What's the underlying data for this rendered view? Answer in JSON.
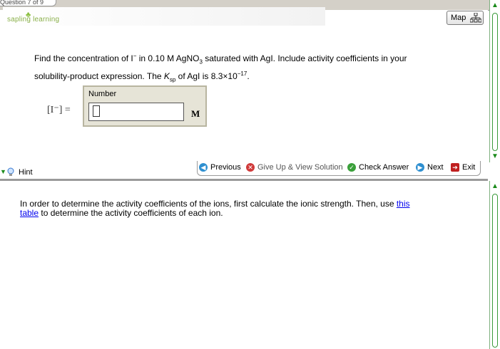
{
  "tabstrip": {
    "title": "Question 7 of 9"
  },
  "logo": {
    "leaf": "♣",
    "text": "sapling learning"
  },
  "map_button": {
    "label": "Map",
    "icon": "sitemap-icon"
  },
  "question": {
    "line1_a": "Find the concentration of I",
    "line1_sup": "−",
    "line1_b": " in 0.10 M AgNO",
    "line1_sub": "3",
    "line1_c": " saturated with AgI. Include activity coefficients in your",
    "line2_a": "solubility-product expression. The ",
    "line2_k": "K",
    "line2_ksub": "sp",
    "line2_b": " of AgI is 8.3×10",
    "line2_sup": "−17",
    "line2_c": "."
  },
  "answer": {
    "label": "Number",
    "value": "",
    "unit": "M",
    "ion_label": "[I⁻] ="
  },
  "nav": {
    "previous": "Previous",
    "give_up": "Give Up & View Solution",
    "check": "Check Answer",
    "next": "Next",
    "exit": "Exit"
  },
  "hint": {
    "label": "Hint",
    "text_a": "In order to determine the activity coefficients of the ions, first calculate the ionic strength.  Then, use ",
    "link_a": "this",
    "link_b": "table",
    "text_b": " to determine the activity coefficients of each ion."
  },
  "colors": {
    "accent_green": "#1a8a1a",
    "link_blue": "#0000ee",
    "answer_panel": "#e6e4d7",
    "logo_green": "#8ab04a"
  }
}
